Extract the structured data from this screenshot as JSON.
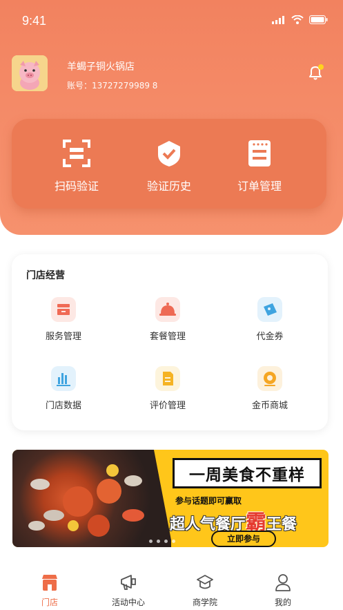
{
  "status_bar": {
    "time": "9:41"
  },
  "store": {
    "name": "羊蝎子铜火锅店",
    "account": "账号：13727279989 8"
  },
  "actions": [
    {
      "label": "扫码验证",
      "icon": "scan-icon"
    },
    {
      "label": "验证历史",
      "icon": "shield-check-icon"
    },
    {
      "label": "订单管理",
      "icon": "order-list-icon"
    }
  ],
  "management": {
    "title": "门店经营",
    "items": [
      {
        "label": "服务管理",
        "icon": "service-icon",
        "color": "#f06a55",
        "bg": "#fde8e4"
      },
      {
        "label": "套餐管理",
        "icon": "meal-cloche-icon",
        "color": "#ee6a54",
        "bg": "#fde8e4"
      },
      {
        "label": "代金券",
        "icon": "voucher-icon",
        "color": "#3fa4e0",
        "bg": "#e3f2fc"
      },
      {
        "label": "门店数据",
        "icon": "bar-chart-icon",
        "color": "#3fa4e0",
        "bg": "#e3f2fc"
      },
      {
        "label": "评价管理",
        "icon": "review-doc-icon",
        "color": "#f5b324",
        "bg": "#fdf4dc"
      },
      {
        "label": "金币商城",
        "icon": "coin-shop-icon",
        "color": "#f5a623",
        "bg": "#fdf1dc"
      }
    ]
  },
  "banner": {
    "headline": "一周美食不重样",
    "sub": "参与话题即可赢取",
    "big_prefix": "超人气餐厅",
    "big_highlight": "霸",
    "big_suffix": "王餐",
    "cta": "立即参与"
  },
  "tabs": [
    {
      "label": "门店",
      "icon": "store-icon",
      "active": true
    },
    {
      "label": "活动中心",
      "icon": "megaphone-icon",
      "active": false
    },
    {
      "label": "商学院",
      "icon": "graduation-cap-icon",
      "active": false
    },
    {
      "label": "我的",
      "icon": "user-icon",
      "active": false
    }
  ],
  "colors": {
    "primary": "#f2825f",
    "active_tab": "#ee6d48",
    "notification_dot": "#ffd21f"
  }
}
